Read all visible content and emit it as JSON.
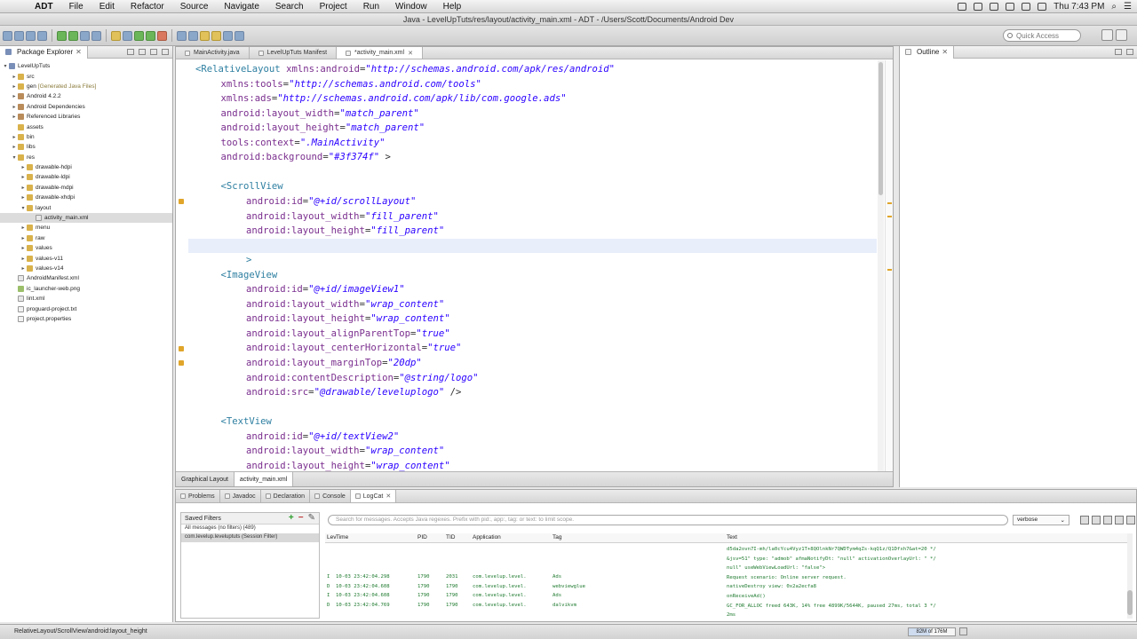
{
  "menubar": {
    "items": [
      "ADT",
      "File",
      "Edit",
      "Refactor",
      "Source",
      "Navigate",
      "Search",
      "Project",
      "Run",
      "Window",
      "Help"
    ],
    "clock": "Thu 7:43 PM"
  },
  "window": {
    "title": "Java - LevelUpTuts/res/layout/activity_main.xml - ADT - /Users/Scott/Documents/Android Dev"
  },
  "toolbar": {
    "quick_access_placeholder": "Quick Access"
  },
  "package_explorer": {
    "title": "Package Explorer",
    "items": [
      {
        "label": "LevelUpTuts",
        "indent": 0,
        "expander": "▾",
        "icon": "project"
      },
      {
        "label": "src",
        "indent": 1,
        "expander": "▸",
        "icon": "folder"
      },
      {
        "label": "gen",
        "suffix": "[Generated Java Files]",
        "indent": 1,
        "expander": "▸",
        "icon": "folder"
      },
      {
        "label": "Android 4.2.2",
        "indent": 1,
        "expander": "▸",
        "icon": "lib"
      },
      {
        "label": "Android Dependencies",
        "indent": 1,
        "expander": "▸",
        "icon": "lib"
      },
      {
        "label": "Referenced Libraries",
        "indent": 1,
        "expander": "▸",
        "icon": "lib"
      },
      {
        "label": "assets",
        "indent": 1,
        "expander": "",
        "icon": "folder"
      },
      {
        "label": "bin",
        "indent": 1,
        "expander": "▸",
        "icon": "folder"
      },
      {
        "label": "libs",
        "indent": 1,
        "expander": "▸",
        "icon": "folder"
      },
      {
        "label": "res",
        "indent": 1,
        "expander": "▾",
        "icon": "folder"
      },
      {
        "label": "drawable-hdpi",
        "indent": 2,
        "expander": "▸",
        "icon": "folder"
      },
      {
        "label": "drawable-ldpi",
        "indent": 2,
        "expander": "▸",
        "icon": "folder"
      },
      {
        "label": "drawable-mdpi",
        "indent": 2,
        "expander": "▸",
        "icon": "folder"
      },
      {
        "label": "drawable-xhdpi",
        "indent": 2,
        "expander": "▸",
        "icon": "folder"
      },
      {
        "label": "layout",
        "indent": 2,
        "expander": "▾",
        "icon": "folder"
      },
      {
        "label": "activity_main.xml",
        "indent": 3,
        "expander": "",
        "icon": "xml",
        "selected": true
      },
      {
        "label": "menu",
        "indent": 2,
        "expander": "▸",
        "icon": "folder"
      },
      {
        "label": "raw",
        "indent": 2,
        "expander": "▸",
        "icon": "folder"
      },
      {
        "label": "values",
        "indent": 2,
        "expander": "▸",
        "icon": "folder"
      },
      {
        "label": "values-v11",
        "indent": 2,
        "expander": "▸",
        "icon": "folder"
      },
      {
        "label": "values-v14",
        "indent": 2,
        "expander": "▸",
        "icon": "folder"
      },
      {
        "label": "AndroidManifest.xml",
        "indent": 1,
        "expander": "",
        "icon": "xml"
      },
      {
        "label": "ic_launcher-web.png",
        "indent": 1,
        "expander": "",
        "icon": "img"
      },
      {
        "label": "lint.xml",
        "indent": 1,
        "expander": "",
        "icon": "xml"
      },
      {
        "label": "proguard-project.txt",
        "indent": 1,
        "expander": "",
        "icon": "file"
      },
      {
        "label": "project.properties",
        "indent": 1,
        "expander": "",
        "icon": "file"
      }
    ]
  },
  "editor": {
    "tabs": [
      {
        "label": "MainActivity.java",
        "active": false
      },
      {
        "label": "LevelUpTuts Manifest",
        "active": false
      },
      {
        "label": "*activity_main.xml",
        "active": true
      }
    ],
    "bottom_tabs": [
      {
        "label": "Graphical Layout",
        "active": false
      },
      {
        "label": "activity_main.xml",
        "active": true
      }
    ],
    "lines": [
      {
        "indent": 0,
        "parts": [
          [
            "tag",
            "<RelativeLayout "
          ],
          [
            "attr",
            "xmlns:android"
          ],
          [
            "punct",
            "="
          ],
          [
            "val",
            "\"http://schemas.android.com/apk/res/android\""
          ]
        ]
      },
      {
        "indent": 1,
        "parts": [
          [
            "attr",
            "xmlns:tools"
          ],
          [
            "punct",
            "="
          ],
          [
            "val",
            "\"http://schemas.android.com/tools\""
          ]
        ]
      },
      {
        "indent": 1,
        "parts": [
          [
            "attr",
            "xmlns:ads"
          ],
          [
            "punct",
            "="
          ],
          [
            "val",
            "\"http://schemas.android.com/apk/lib/com.google.ads\""
          ]
        ]
      },
      {
        "indent": 1,
        "parts": [
          [
            "attr",
            "android:layout_width"
          ],
          [
            "punct",
            "="
          ],
          [
            "val",
            "\"match_parent\""
          ]
        ]
      },
      {
        "indent": 1,
        "parts": [
          [
            "attr",
            "android:layout_height"
          ],
          [
            "punct",
            "="
          ],
          [
            "val",
            "\"match_parent\""
          ]
        ]
      },
      {
        "indent": 1,
        "parts": [
          [
            "attr",
            "tools:context"
          ],
          [
            "punct",
            "="
          ],
          [
            "val",
            "\".MainActivity\""
          ]
        ]
      },
      {
        "indent": 1,
        "parts": [
          [
            "attr",
            "android:background"
          ],
          [
            "punct",
            "="
          ],
          [
            "val",
            "\"#3f374f\""
          ],
          [
            "punct",
            " >"
          ]
        ]
      },
      {
        "indent": 0,
        "parts": []
      },
      {
        "indent": 1,
        "parts": [
          [
            "tag",
            "<ScrollView"
          ]
        ]
      },
      {
        "indent": 2,
        "parts": [
          [
            "attr",
            "android:id"
          ],
          [
            "punct",
            "="
          ],
          [
            "val",
            "\"@+id/scrollLayout\""
          ]
        ]
      },
      {
        "indent": 2,
        "parts": [
          [
            "attr",
            "android:layout_width"
          ],
          [
            "punct",
            "="
          ],
          [
            "val",
            "\"fill_parent\""
          ]
        ]
      },
      {
        "indent": 2,
        "parts": [
          [
            "attr",
            "android:layout_height"
          ],
          [
            "punct",
            "="
          ],
          [
            "val",
            "\"fill_parent\""
          ]
        ]
      },
      {
        "indent": 0,
        "parts": []
      },
      {
        "indent": 2,
        "parts": [
          [
            "tag",
            ">"
          ]
        ]
      },
      {
        "indent": 1,
        "parts": [
          [
            "tag",
            "<ImageView"
          ]
        ]
      },
      {
        "indent": 2,
        "parts": [
          [
            "attr",
            "android:id"
          ],
          [
            "punct",
            "="
          ],
          [
            "val",
            "\"@+id/imageView1\""
          ]
        ]
      },
      {
        "indent": 2,
        "parts": [
          [
            "attr",
            "android:layout_width"
          ],
          [
            "punct",
            "="
          ],
          [
            "val",
            "\"wrap_content\""
          ]
        ]
      },
      {
        "indent": 2,
        "parts": [
          [
            "attr",
            "android:layout_height"
          ],
          [
            "punct",
            "="
          ],
          [
            "val",
            "\"wrap_content\""
          ]
        ]
      },
      {
        "indent": 2,
        "parts": [
          [
            "attr",
            "android:layout_alignParentTop"
          ],
          [
            "punct",
            "="
          ],
          [
            "val",
            "\"true\""
          ]
        ]
      },
      {
        "indent": 2,
        "parts": [
          [
            "attr",
            "android:layout_centerHorizontal"
          ],
          [
            "punct",
            "="
          ],
          [
            "val",
            "\"true\""
          ]
        ]
      },
      {
        "indent": 2,
        "parts": [
          [
            "attr",
            "android:layout_marginTop"
          ],
          [
            "punct",
            "="
          ],
          [
            "val",
            "\"20dp\""
          ]
        ]
      },
      {
        "indent": 2,
        "parts": [
          [
            "attr",
            "android:contentDescription"
          ],
          [
            "punct",
            "="
          ],
          [
            "val",
            "\"@string/logo\""
          ]
        ]
      },
      {
        "indent": 2,
        "parts": [
          [
            "attr",
            "android:src"
          ],
          [
            "punct",
            "="
          ],
          [
            "val",
            "\"@drawable/leveluplogo\""
          ],
          [
            "punct",
            " />"
          ]
        ]
      },
      {
        "indent": 0,
        "parts": []
      },
      {
        "indent": 1,
        "parts": [
          [
            "tag",
            "<TextView"
          ]
        ]
      },
      {
        "indent": 2,
        "parts": [
          [
            "attr",
            "android:id"
          ],
          [
            "punct",
            "="
          ],
          [
            "val",
            "\"@+id/textView2\""
          ]
        ]
      },
      {
        "indent": 2,
        "parts": [
          [
            "attr",
            "android:layout_width"
          ],
          [
            "punct",
            "="
          ],
          [
            "val",
            "\"wrap_content\""
          ]
        ]
      },
      {
        "indent": 2,
        "parts": [
          [
            "attr",
            "android:layout_height"
          ],
          [
            "punct",
            "="
          ],
          [
            "val",
            "\"wrap_content\""
          ]
        ]
      }
    ]
  },
  "outline": {
    "title": "Outline"
  },
  "bottom_panel": {
    "tabs": [
      {
        "label": "Problems",
        "active": false
      },
      {
        "label": "Javadoc",
        "active": false
      },
      {
        "label": "Declaration",
        "active": false
      },
      {
        "label": "Console",
        "active": false
      },
      {
        "label": "LogCat",
        "active": true
      }
    ],
    "saved_filters_title": "Saved Filters",
    "filters": [
      {
        "label": "All messages (no filters) (489)",
        "selected": false
      },
      {
        "label": "com.levelup.leveluptuts (Session Filter)",
        "selected": true
      }
    ],
    "search_placeholder": "Search for messages. Accepts Java regexes. Prefix with pid:, app:, tag: or text: to limit scope.",
    "level": "verbose",
    "columns": [
      "Lev",
      "Time",
      "PID",
      "TID",
      "Application",
      "Tag",
      "Text"
    ],
    "rows": [
      {
        "level": "I",
        "time": "10-03 23:42:04.298",
        "pid": "1790",
        "tid": "2031",
        "app": "com.levelup.level.",
        "tag": "Ads"
      },
      {
        "level": "D",
        "time": "10-03 23:42:04.608",
        "pid": "1790",
        "tid": "1790",
        "app": "com.levelup.level.",
        "tag": "webviewglue"
      },
      {
        "level": "I",
        "time": "10-03 23:42:04.608",
        "pid": "1790",
        "tid": "1790",
        "app": "com.levelup.level.",
        "tag": "Ads"
      },
      {
        "level": "D",
        "time": "10-03 23:42:04.769",
        "pid": "1790",
        "tid": "1790",
        "app": "com.levelup.level.",
        "tag": "dalvikvm"
      }
    ],
    "text_lines": [
      "d5da2ovn7I-mh/la0cYcu4Vyz1T+8QOlnkNr7QWDTym4qZs-kqQ1z/Q1Dfxh7&at=20 */",
      "&jsv=51\" type: \"admob\" afmaNotifyDt: \"null\" activationOverlayUrl: \" */",
      "null\" useWebViewLoadUrl: \"false\">",
      "Request scenario: Online server request.",
      "nativeDestroy view: 0x2a2ecfa8",
      "onReceiveAd()",
      "GC_FOR_ALLOC freed 643K, 14% free 4899K/5644K, paused 27ms, total 3 */",
      "2ms"
    ]
  },
  "status": {
    "path": "RelativeLayout/ScrollView/android:layout_height",
    "heap": "82M of 176M",
    "heap_used_fraction": 0.47
  }
}
